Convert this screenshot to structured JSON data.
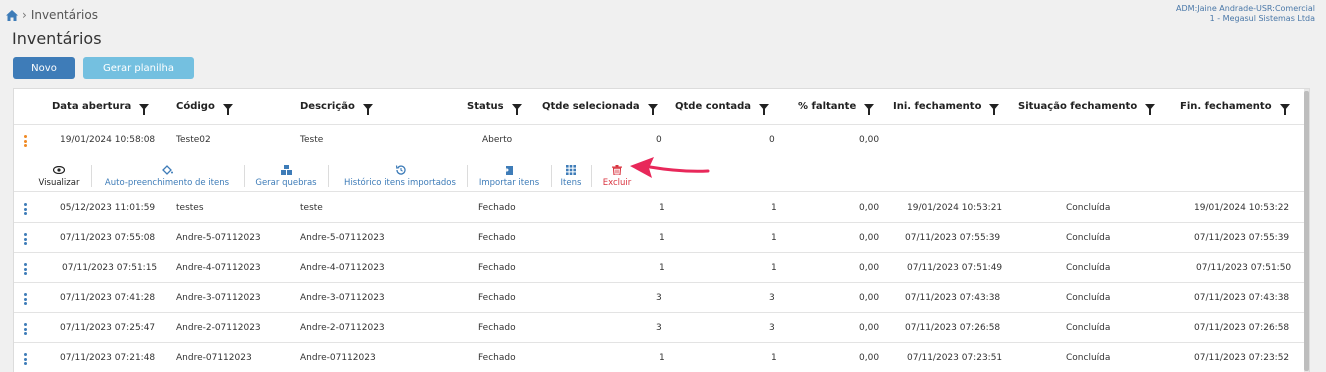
{
  "breadcrumb": {
    "page": "Inventários"
  },
  "user": {
    "line1": "ADM:Jaine Andrade-USR:Comercial",
    "line2": "1 - Megasul Sistemas Ltda"
  },
  "page_title": "Inventários",
  "buttons": {
    "novo": "Novo",
    "gerar": "Gerar planilha"
  },
  "columns": [
    "Data abertura",
    "Código",
    "Descrição",
    "Status",
    "Qtde selecionada",
    "Qtde contada",
    "% faltante",
    "Ini. fechamento",
    "Situação fechamento",
    "Fin. fechamento"
  ],
  "rows": [
    {
      "data": "19/01/2024 10:58:08",
      "codigo": "Teste02",
      "descricao": "Teste",
      "status": "Aberto",
      "qsel": "0",
      "qcont": "0",
      "falt": "0,00",
      "ini": "",
      "sit": "",
      "fin": ""
    },
    {
      "data": "05/12/2023 11:01:59",
      "codigo": "testes",
      "descricao": "teste",
      "status": "Fechado",
      "qsel": "1",
      "qcont": "1",
      "falt": "0,00",
      "ini": "19/01/2024 10:53:21",
      "sit": "Concluída",
      "fin": "19/01/2024 10:53:22"
    },
    {
      "data": "07/11/2023 07:55:08",
      "codigo": "Andre-5-07112023",
      "descricao": "Andre-5-07112023",
      "status": "Fechado",
      "qsel": "1",
      "qcont": "1",
      "falt": "0,00",
      "ini": "07/11/2023 07:55:39",
      "sit": "Concluída",
      "fin": "07/11/2023 07:55:39"
    },
    {
      "data": "07/11/2023 07:51:15",
      "codigo": "Andre-4-07112023",
      "descricao": "Andre-4-07112023",
      "status": "Fechado",
      "qsel": "1",
      "qcont": "1",
      "falt": "0,00",
      "ini": "07/11/2023 07:51:49",
      "sit": "Concluída",
      "fin": "07/11/2023 07:51:50"
    },
    {
      "data": "07/11/2023 07:41:28",
      "codigo": "Andre-3-07112023",
      "descricao": "Andre-3-07112023",
      "status": "Fechado",
      "qsel": "3",
      "qcont": "3",
      "falt": "0,00",
      "ini": "07/11/2023 07:43:38",
      "sit": "Concluída",
      "fin": "07/11/2023 07:43:38"
    },
    {
      "data": "07/11/2023 07:25:47",
      "codigo": "Andre-2-07112023",
      "descricao": "Andre-2-07112023",
      "status": "Fechado",
      "qsel": "3",
      "qcont": "3",
      "falt": "0,00",
      "ini": "07/11/2023 07:26:58",
      "sit": "Concluída",
      "fin": "07/11/2023 07:26:58"
    },
    {
      "data": "07/11/2023 07:21:48",
      "codigo": "Andre-07112023",
      "descricao": "Andre-07112023",
      "status": "Fechado",
      "qsel": "1",
      "qcont": "1",
      "falt": "0,00",
      "ini": "07/11/2023 07:23:51",
      "sit": "Concluída",
      "fin": "07/11/2023 07:23:52"
    }
  ],
  "actions": {
    "visualizar": "Visualizar",
    "autopreench": "Auto-preenchimento de itens",
    "quebras": "Gerar quebras",
    "historico": "Histórico itens importados",
    "importar": "Importar itens",
    "itens": "Itens",
    "excluir": "Excluir"
  },
  "colors": {
    "primary": "#3e7cb8",
    "secondary": "#74c0e0",
    "danger": "#d9333f",
    "arrow": "#e8285a"
  }
}
